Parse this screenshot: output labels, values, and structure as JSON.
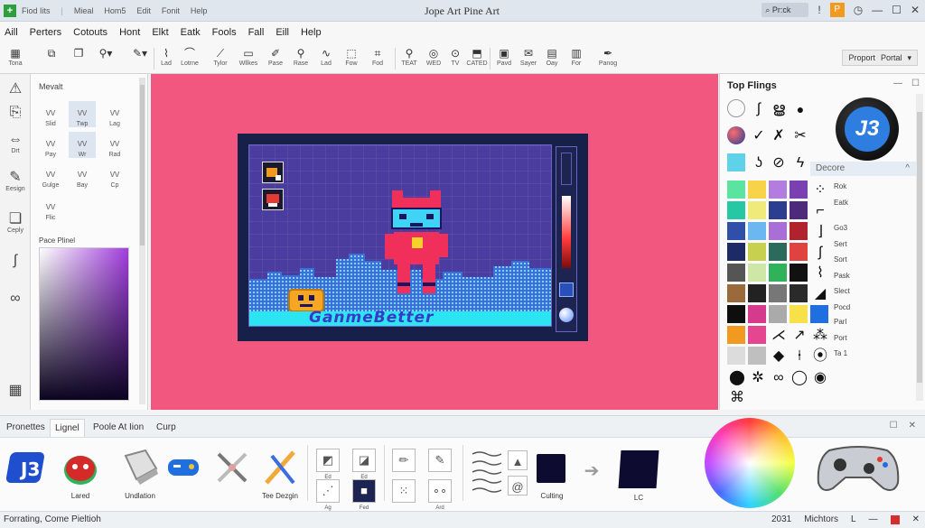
{
  "titlebar": {
    "menu": [
      "Fiod Iits",
      "Mieal",
      "Hom5",
      "Edit",
      "Fonit",
      "Help"
    ],
    "title": "Jope Art Pine Art",
    "search_label": "Pr:ck",
    "orange_label": "P"
  },
  "menubar": [
    "Aill",
    "Perters",
    "Cotouts",
    "Hont",
    "Elkt",
    "Eatk",
    "Fools",
    "Fall",
    "Eill",
    "Help"
  ],
  "toolbar": {
    "tools": [
      "Tona",
      "",
      "",
      "",
      "",
      "Lad",
      "Lotrne",
      "Tylor",
      "Wllkes",
      "Pase",
      "Rase",
      "Lad",
      "Fow",
      "Fod",
      "TEAT",
      "WED",
      "TV",
      "CATED",
      "Pavd",
      "Sayer",
      "Oay",
      "For",
      "Panog"
    ],
    "property_label": "Proport",
    "portal_label": "Portal"
  },
  "leftstrip": [
    "",
    "",
    "Drt",
    "Eesign",
    "Ceply",
    "",
    ""
  ],
  "brushpanel": {
    "title": "Mevalt",
    "brushes": [
      "Slid",
      "Twp",
      "Lag",
      "Pay",
      "Wr",
      "Rad",
      "Gulge",
      "Bay",
      "Cp",
      "Flic"
    ],
    "picker_label": "Pace Plinel"
  },
  "canvas": {
    "game_title": "GanmeBetter"
  },
  "rightpanel": {
    "title": "Top Flings",
    "logo_text": "J3",
    "decore_title": "Decore",
    "decore_items": [
      "Rok",
      "Eatk",
      "Go3",
      "Sert",
      "Sort",
      "Pask",
      "Slect",
      "Pocd",
      "Parl",
      "Port",
      "Ta 1"
    ]
  },
  "bottompanel": {
    "tabs": [
      "Pronettes",
      "Lignel",
      "Poole At Iion",
      "Curp"
    ],
    "assets": [
      "",
      "Lared",
      "Undlation",
      "",
      "Tee Dezgin"
    ],
    "mini_caps": [
      "Ed",
      "Ed",
      "Ag",
      "Fed",
      "",
      "Ard"
    ],
    "culting_label": "Culting",
    "lc_label": "LC"
  },
  "status": {
    "left": "Forrating, Come Pieltioh",
    "year": "2031",
    "right": "Michtors",
    "letter": "L"
  },
  "colors": {
    "canvas_bg": "#f2587f",
    "artboard_bg": "#172049",
    "accent_cyan": "#2ce4f2",
    "robot_red": "#f0305a"
  }
}
